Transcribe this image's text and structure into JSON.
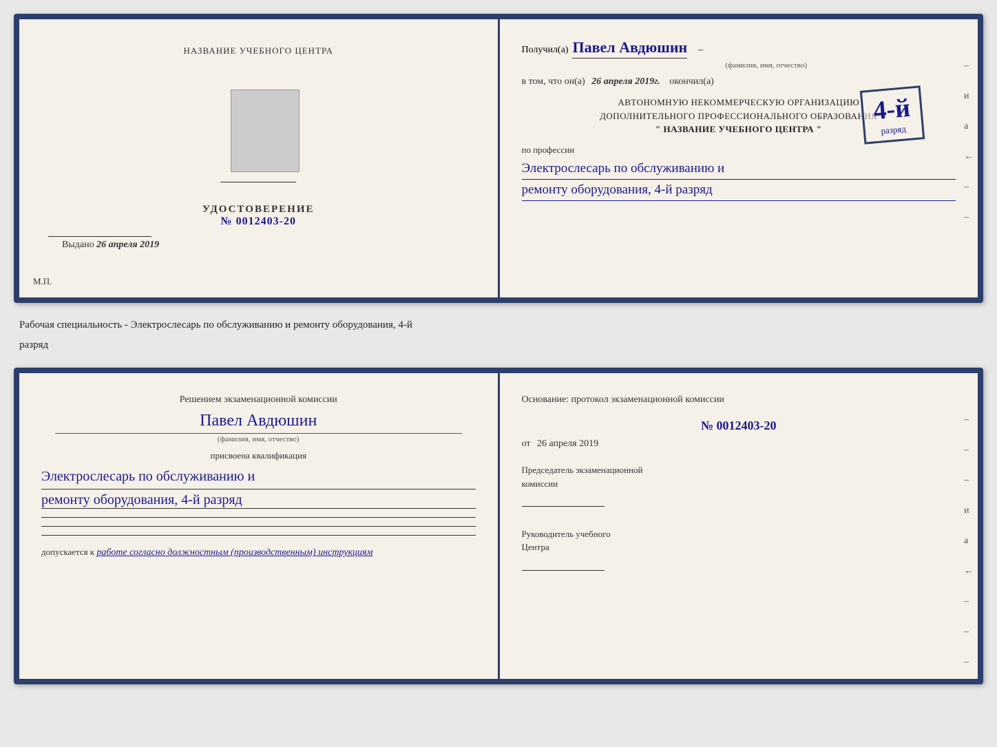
{
  "top_left": {
    "title": "НАЗВАНИЕ УЧЕБНОГО ЦЕНТРА",
    "udostoverenie_label": "УДОСТОВЕРЕНИЕ",
    "number": "№ 0012403-20",
    "vydano_label": "Выдано",
    "vydano_date": "26 апреля 2019",
    "mp_label": "М.П."
  },
  "top_right": {
    "poluchil_label": "Получил(а)",
    "name": "Павел Авдюшин",
    "name_sub": "(фамилия, имя, отчество)",
    "vtom_label": "в том, что он(а)",
    "date": "26 апреля 2019г.",
    "okoncil_label": "окончил(а)",
    "grade_label": "4-й",
    "grade_sub": "разряд",
    "org_line1": "АВТОНОМНУЮ НЕКОММЕРЧЕСКУЮ ОРГАНИЗАЦИЮ",
    "org_line2": "ДОПОЛНИТЕЛЬНОГО ПРОФЕССИОНАЛЬНОГО ОБРАЗОВАНИЯ",
    "org_name": "\" НАЗВАНИЕ УЧЕБНОГО ЦЕНТРА \"",
    "po_professii_label": "по профессии",
    "profession_line1": "Электрослесарь по обслуживанию и",
    "profession_line2": "ремонту оборудования, 4-й разряд",
    "side_marks": [
      "–",
      "и",
      "а",
      "←",
      "–",
      "–",
      "–"
    ]
  },
  "separator": {
    "text1": "Рабочая специальность - Электрослесарь по обслуживанию и ремонту оборудования, 4-й",
    "text2": "разряд"
  },
  "bottom_left": {
    "resolution_text": "Решением экзаменационной комиссии",
    "name": "Павел Авдюшин",
    "name_sub": "(фамилия, имя, отчество)",
    "prisvoena_label": "присвоена квалификация",
    "qual_line1": "Электрослесарь по обслуживанию и",
    "qual_line2": "ремонту оборудования, 4-й разряд",
    "dopuskaetsya_label": "допускается к",
    "dopusk_text": "работе согласно должностным (производственным) инструкциям"
  },
  "bottom_right": {
    "osnov_label": "Основание: протокол экзаменационной комиссии",
    "protocol_number": "№ 0012403-20",
    "ot_label": "от",
    "ot_date": "26 апреля 2019",
    "chairman_line1": "Председатель экзаменационной",
    "chairman_line2": "комиссии",
    "rukovoditel_line1": "Руководитель учебного",
    "rukovoditel_line2": "Центра",
    "side_marks": [
      "–",
      "–",
      "–",
      "и",
      "а",
      "←",
      "–",
      "–",
      "–"
    ]
  }
}
